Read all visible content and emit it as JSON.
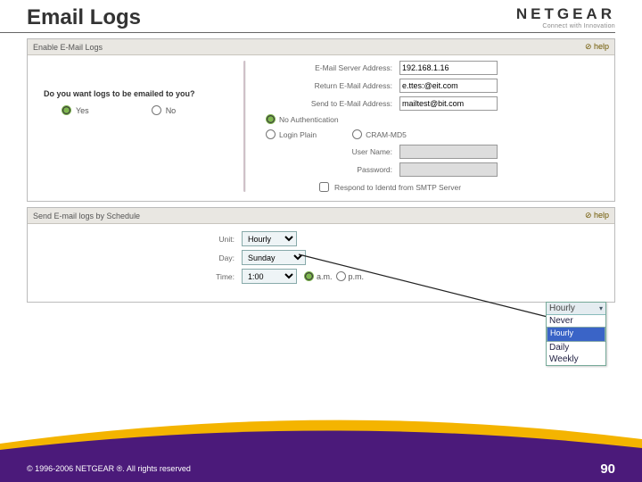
{
  "header": {
    "title": "Email Logs",
    "logo": "NETGEAR",
    "tagline": "Connect with Innovation"
  },
  "enable_section": {
    "title": "Enable E-Mail Logs",
    "help": "⊘ help",
    "question": "Do you want logs to be emailed to you?",
    "yes_label": "Yes",
    "no_label": "No",
    "fields": {
      "server_label": "E-Mail Server Address:",
      "server_value": "192.168.1.16",
      "return_label": "Return E-Mail Address:",
      "return_value": "e.ttes:@eit.com",
      "sendto_label": "Send to E-Mail Address:",
      "sendto_value": "mailtest@bit.com",
      "noauth_label": "No Authentication",
      "loginplain_label": "Login Plain",
      "crammd5_label": "CRAM-MD5",
      "username_label": "User Name:",
      "password_label": "Password:",
      "ident_label": "Respond to Identd from SMTP Server"
    }
  },
  "schedule_section": {
    "title": "Send E-mail logs by Schedule",
    "help": "⊘ help",
    "unit_label": "Unit:",
    "unit_value": "Hourly",
    "day_label": "Day:",
    "day_value": "Sunday",
    "time_label": "Time:",
    "time_value": "1:00",
    "am_label": "a.m.",
    "pm_label": "p.m."
  },
  "dropdown_popout": {
    "current": "Hourly",
    "options": [
      "Never",
      "Hourly",
      "Daily",
      "Weekly"
    ]
  },
  "footer": {
    "copyright": "© 1996-2006 NETGEAR ®. All rights reserved",
    "page": "90"
  }
}
